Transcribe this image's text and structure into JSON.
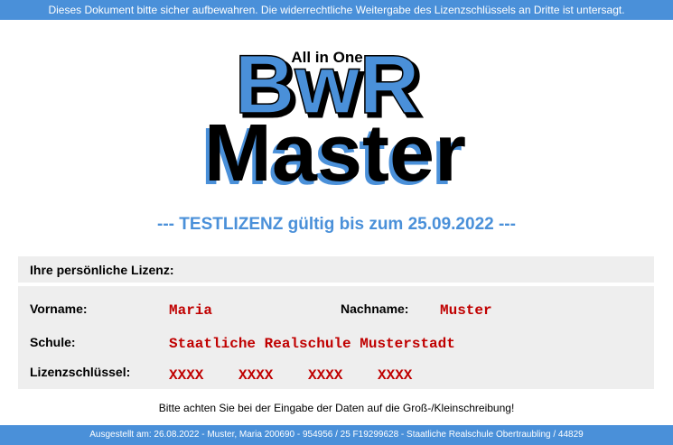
{
  "banner_top": "Dieses Dokument bitte sicher aufbewahren. Die widerrechtliche Weitergabe des Lizenzschlüssels an Dritte ist untersagt.",
  "logo": {
    "tagline": "All in One",
    "brand": "BwR",
    "product": "Master",
    "colors": {
      "blue": "#4a90d9",
      "black": "#000000"
    }
  },
  "testlizenz": "--- TESTLIZENZ gültig bis zum 25.09.2022 ---",
  "license": {
    "header": "Ihre persönliche Lizenz:",
    "vorname_label": "Vorname:",
    "vorname": "Maria",
    "nachname_label": "Nachname:",
    "nachname": "Muster",
    "schule_label": "Schule:",
    "schule": "Staatliche Realschule Musterstadt",
    "key_label": "Lizenzschlüssel:",
    "key_parts": [
      "XXXX",
      "XXXX",
      "XXXX",
      "XXXX"
    ]
  },
  "hint": "Bitte achten Sie bei der Eingabe der Daten auf die Groß-/Kleinschreibung!",
  "banner_bottom": "Ausgestellt am: 26.08.2022 - Muster, Maria 200690 - 954956 / 25 F19299628 - Staatliche Realschule Obertraubling / 44829",
  "accent_color": "#4a90d9",
  "value_color": "#c00000"
}
